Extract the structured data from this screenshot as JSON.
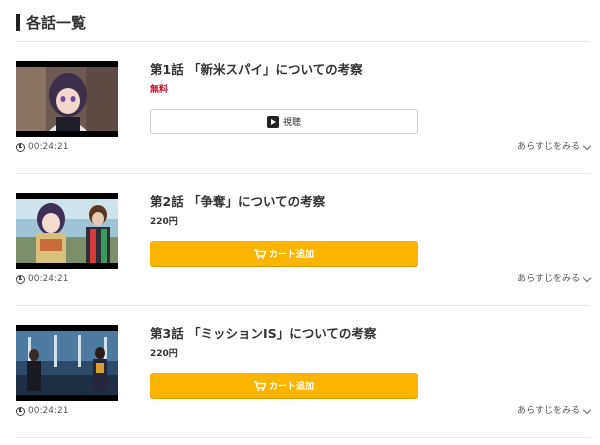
{
  "section": {
    "title": "各話一覧"
  },
  "episodes": [
    {
      "title": "第1話 「新米スパイ」についての考察",
      "duration": "00:24:21",
      "price": "無料",
      "button_label": "視聴",
      "button_type": "watch",
      "synopsis_label": "あらすじをみる"
    },
    {
      "title": "第2話 「争奪」についての考察",
      "duration": "00:24:21",
      "price": "220円",
      "button_label": "カート追加",
      "button_type": "cart",
      "synopsis_label": "あらすじをみる"
    },
    {
      "title": "第3話 「ミッションIS」についての考察",
      "duration": "00:24:21",
      "price": "220円",
      "button_label": "カート追加",
      "button_type": "cart",
      "synopsis_label": "あらすじをみる"
    }
  ],
  "colors": {
    "cart_button": "#fbb400",
    "free_price": "#c8102e",
    "text": "#333333"
  },
  "icons": {
    "watch": "play-icon",
    "cart": "cart-icon",
    "duration": "clock-icon",
    "synopsis": "chevron-down-icon"
  }
}
